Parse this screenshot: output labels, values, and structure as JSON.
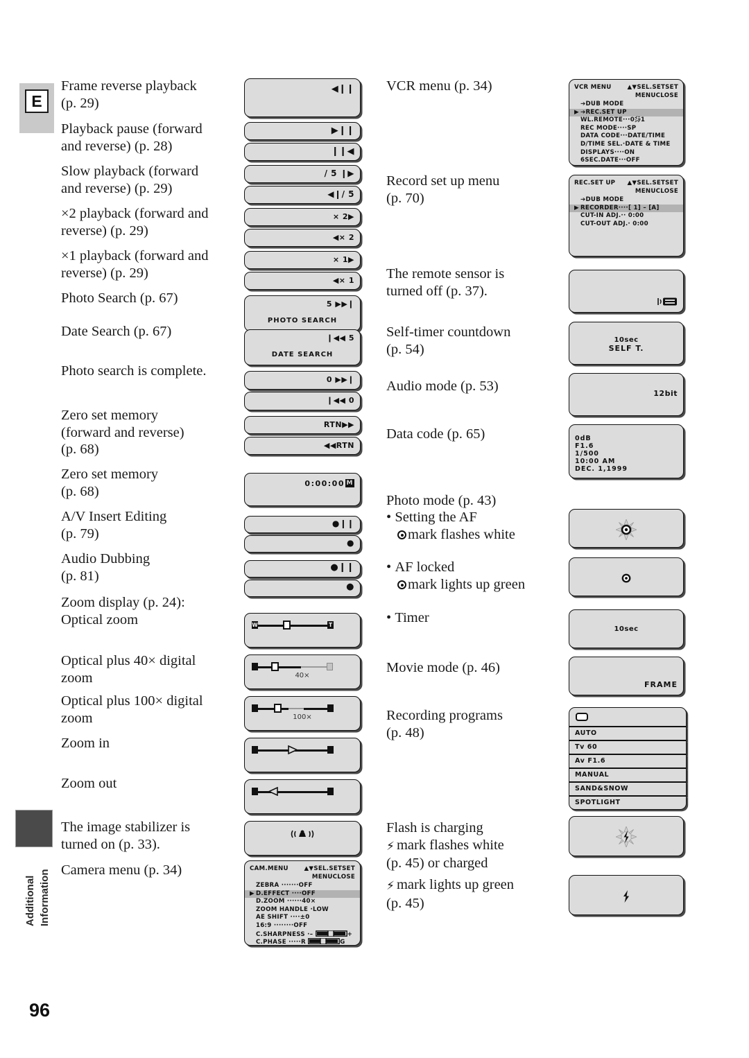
{
  "page": {
    "badge_letter": "E",
    "side_label_line1": "Additional",
    "side_label_line2": "Information",
    "number": "96"
  },
  "left_column": {
    "captions": [
      {
        "lines": [
          "Frame reverse playback",
          "(p. 29)"
        ]
      },
      {
        "lines": [
          "Playback pause (forward",
          "and reverse) (p. 28)"
        ]
      },
      {
        "lines": [
          "Slow playback (forward",
          "and reverse) (p. 29)"
        ]
      },
      {
        "lines": [
          "×2 playback (forward and",
          "reverse) (p. 29)"
        ]
      },
      {
        "lines": [
          "×1 playback (forward and",
          "reverse) (p. 29)"
        ]
      },
      {
        "lines": [
          "Photo Search (p. 67)"
        ]
      },
      {
        "lines": [
          "Date Search (p. 67)"
        ]
      },
      {
        "lines": [
          "Photo search is complete."
        ]
      },
      {
        "lines": [
          "Zero set memory",
          "(forward and reverse)",
          "(p. 68)"
        ]
      },
      {
        "lines": [
          "Zero set memory",
          "(p. 68)"
        ]
      },
      {
        "lines": [
          "A/V Insert Editing",
          "(p. 79)"
        ]
      },
      {
        "lines": [
          "Audio Dubbing",
          "(p. 81)"
        ]
      },
      {
        "lines": [
          "Zoom display (p. 24):",
          "Optical zoom"
        ]
      },
      {
        "lines": [
          "Optical plus 40× digital",
          "zoom"
        ]
      },
      {
        "lines": [
          "Optical plus 100× digital",
          "zoom"
        ]
      },
      {
        "lines": [
          "Zoom in"
        ]
      },
      {
        "lines": [
          "Zoom out"
        ]
      },
      {
        "lines": [
          "The image stabilizer is",
          "turned on (p. 33)."
        ]
      },
      {
        "lines": [
          "Camera menu (p. 34)"
        ]
      }
    ]
  },
  "right_column": {
    "captions": [
      {
        "lines": [
          "VCR menu (p. 34)"
        ]
      },
      {
        "lines": [
          "Record set up menu",
          "(p. 70)"
        ]
      },
      {
        "lines": [
          "The remote sensor is",
          "turned off (p. 37)."
        ]
      },
      {
        "lines": [
          "Self-timer countdown",
          "(p. 54)"
        ]
      },
      {
        "lines": [
          "Audio mode (p. 53)"
        ]
      },
      {
        "lines": [
          "Data code (p. 65)"
        ]
      },
      {
        "lines": [
          "Photo mode (p. 43)"
        ]
      },
      {
        "lines": [
          "Setting the AF",
          "mark flashes white"
        ]
      },
      {
        "lines": [
          "AF locked",
          "mark lights up green"
        ]
      },
      {
        "lines": [
          "Timer"
        ]
      },
      {
        "lines": [
          "Movie mode (p. 46)"
        ]
      },
      {
        "lines": [
          "Recording programs",
          "(p. 48)"
        ]
      },
      {
        "lines": [
          "Flash is charging",
          "mark flashes white",
          "(p. 45) or charged"
        ]
      },
      {
        "lines": [
          "mark lights up green",
          "(p. 45)"
        ]
      }
    ]
  },
  "displays_left": {
    "frame_reverse": "◀❙❙",
    "pause_forward": "▶❙❙",
    "pause_reverse": "❙❙◀",
    "slow_forward": "/ 5 ❙▶",
    "slow_reverse": "◀❙/ 5",
    "x2_forward": "× 2▶",
    "x2_reverse": "◀× 2",
    "x1_forward": "× 1▶",
    "x1_reverse": "◀× 1",
    "photo_search_count": "5  ▶▶❙",
    "photo_search_label": "PHOTO  SEARCH",
    "date_search_count": "❙◀◀  5",
    "date_search_label": "DATE  SEARCH",
    "search_complete_forward": "0  ▶▶❙",
    "search_complete_reverse": "❙◀◀  0",
    "zero_rtn_forward": "RTN▶▶",
    "zero_rtn_reverse": "◀◀RTN",
    "zero_timecode": "0:00:00",
    "zero_timecode_mark": "M",
    "av_insert_pause": "●❙❙",
    "av_insert_rec": "●",
    "audio_dub_pause": "●❙❙",
    "audio_dub_rec": "●",
    "zoom_40x_label": "40×",
    "zoom_100x_label": "100×",
    "zoom_w": "W",
    "zoom_t": "T"
  },
  "cam_menu": {
    "title": "CAM.MENU",
    "sel": "▲▼SEL.",
    "set": "SETSET",
    "close": "MENUCLOSE",
    "rows": [
      {
        "arrow": "",
        "label": "ZEBRA ·······OFF",
        "selected": false
      },
      {
        "arrow": "▶",
        "label": "D.EFFECT ····OFF",
        "selected": true
      },
      {
        "arrow": "",
        "label": "D.ZOOM ······40×",
        "selected": false
      },
      {
        "arrow": "",
        "label": "ZOOM HANDLE ·LOW",
        "selected": false
      },
      {
        "arrow": "",
        "label": "AE SHIFT ····±0",
        "selected": false
      },
      {
        "arrow": "",
        "label": "16:9 ········OFF",
        "selected": false
      }
    ],
    "sharpness_label": "C.SHARPNESS ·",
    "sharpness_left": "–",
    "sharpness_right": "+",
    "phase_label": "C.PHASE ·····",
    "phase_left": "R",
    "phase_right": "G",
    "more": "↓"
  },
  "vcr_menu": {
    "title": "VCR MENU",
    "sel": "▲▼SEL.",
    "set": "SETSET",
    "close": "MENUCLOSE",
    "rows": [
      {
        "arrow": "",
        "label": "➔DUB MODE",
        "selected": false
      },
      {
        "arrow": "▶",
        "label": "➔REC.SET UP",
        "selected": true
      },
      {
        "arrow": "",
        "label": "WL.REMOTE···0㌄1",
        "selected": false
      },
      {
        "arrow": "",
        "label": "REC MODE····SP",
        "selected": false
      },
      {
        "arrow": "",
        "label": "DATA CODE···DATE/TIME",
        "selected": false
      },
      {
        "arrow": "",
        "label": "D/TIME SEL.·DATE & TIME",
        "selected": false
      },
      {
        "arrow": "",
        "label": "DISPLAYS····ON",
        "selected": false
      },
      {
        "arrow": "",
        "label": "6SEC.DATE···OFF",
        "selected": false
      }
    ],
    "more": "↓"
  },
  "rec_setup_menu": {
    "title": "REC.SET UP",
    "sel": "▲▼SEL.",
    "set": "SETSET",
    "close": "MENUCLOSE",
    "rows": [
      {
        "arrow": "",
        "label": "➔DUB MODE",
        "selected": false
      },
      {
        "arrow": "▶",
        "label": "RECORDER····[ 1] – [A]",
        "selected": true
      },
      {
        "arrow": "",
        "label": "CUT-IN ADJ.·· 0:00",
        "selected": false
      },
      {
        "arrow": "",
        "label": "CUT-OUT ADJ.· 0:00",
        "selected": false
      }
    ]
  },
  "displays_right": {
    "remote_off_icon": "remote-sensor-off-icon",
    "self_timer_sec": "10sec",
    "self_timer_label": "SELF T.",
    "audio_mode": "12bit",
    "data_code_lines": [
      "0dB",
      "F1.6",
      "1/500",
      "10:00 AM",
      "DEC. 1,1999"
    ],
    "movie_mode": "FRAME",
    "timer_sec": "10sec"
  },
  "recording_programs": {
    "items": [
      "AUTO",
      "Tv 60",
      "Av F1.6",
      "MANUAL",
      "SAND&SNOW",
      "SPOTLIGHT"
    ],
    "top_icon": "easy-recording-icon"
  }
}
